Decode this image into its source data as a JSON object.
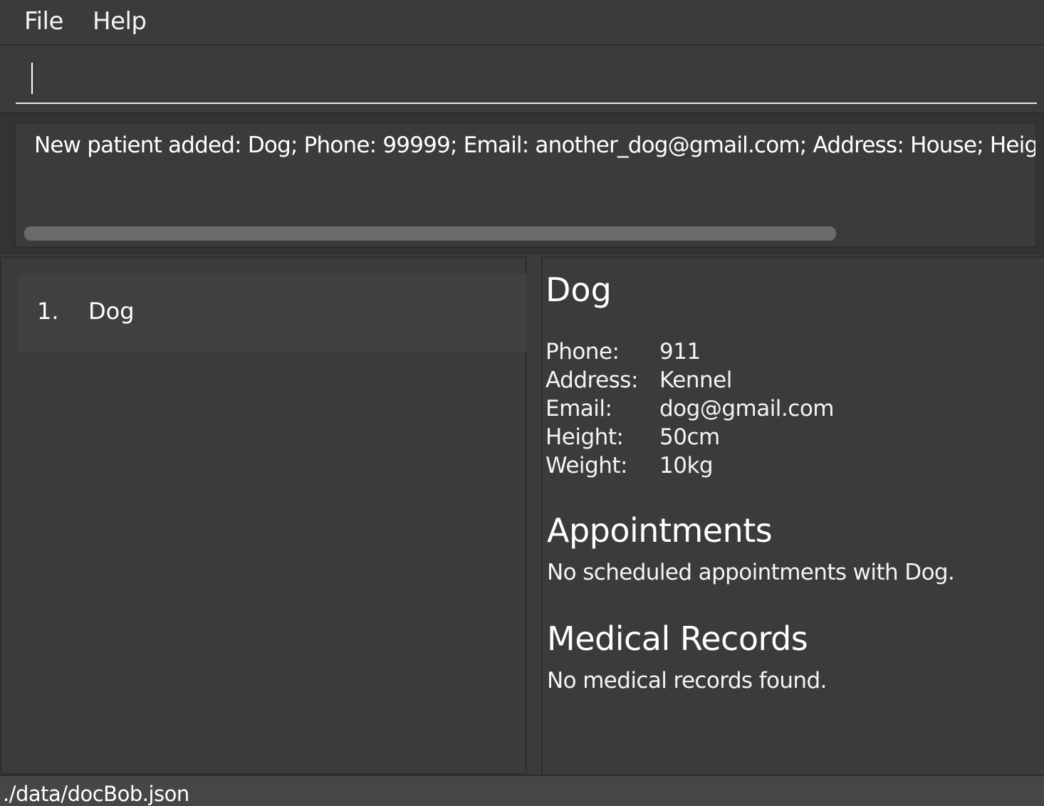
{
  "menubar": {
    "file_label": "File",
    "help_label": "Help"
  },
  "command": {
    "value": "",
    "placeholder": ""
  },
  "result": {
    "message": "New patient added: Dog; Phone: 99999; Email: another_dog@gmail.com; Address: House; Height"
  },
  "patient_list": {
    "items": [
      {
        "index": "1.",
        "name": "Dog"
      }
    ]
  },
  "detail": {
    "name": "Dog",
    "fields": {
      "phone_label": "Phone:",
      "phone_value": "911",
      "address_label": "Address:",
      "address_value": "Kennel",
      "email_label": "Email:",
      "email_value": "dog@gmail.com",
      "height_label": "Height:",
      "height_value": "50cm",
      "weight_label": "Weight:",
      "weight_value": "10kg"
    },
    "appointments_title": "Appointments",
    "appointments_text": "No scheduled appointments with Dog.",
    "records_title": "Medical Records",
    "records_text": "No medical records found."
  },
  "statusbar": {
    "file_path": "./data/docBob.json"
  },
  "colors": {
    "background": "#3b3b3b",
    "text": "#ffffff",
    "scrollbar_thumb": "#6a6a6a"
  }
}
